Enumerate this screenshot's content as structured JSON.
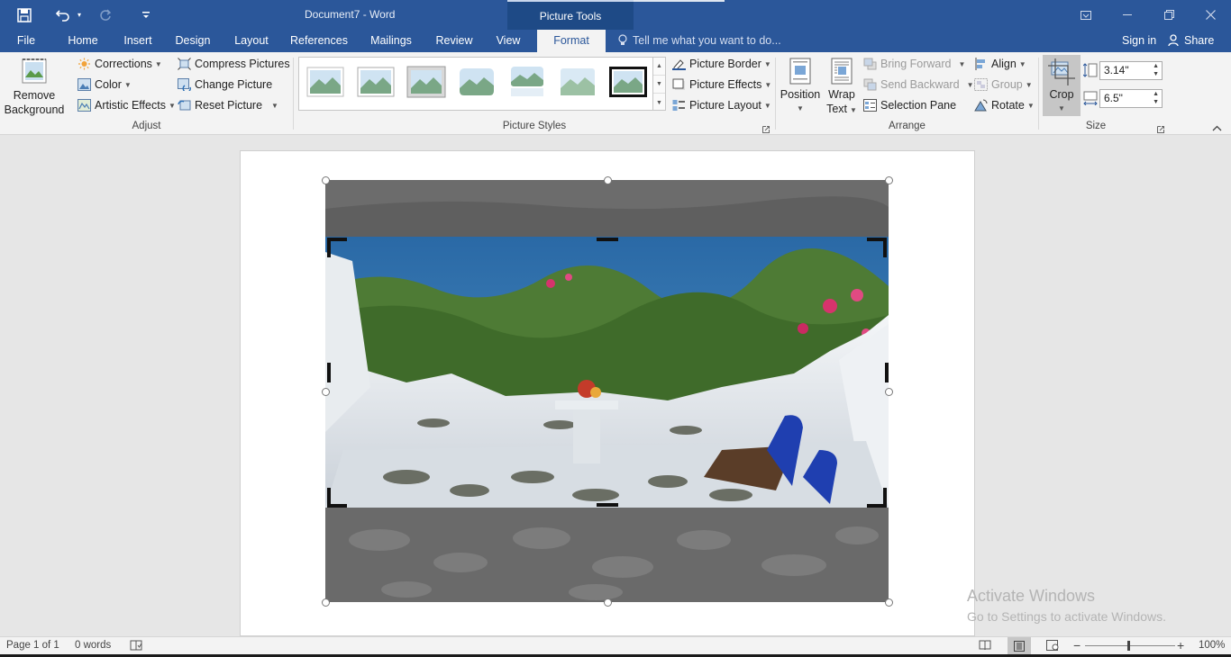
{
  "titlebar": {
    "doc_title": "Document7 - Word",
    "contextual_group": "Picture Tools"
  },
  "tabs": [
    {
      "label": "File"
    },
    {
      "label": "Home"
    },
    {
      "label": "Insert"
    },
    {
      "label": "Design"
    },
    {
      "label": "Layout"
    },
    {
      "label": "References"
    },
    {
      "label": "Mailings"
    },
    {
      "label": "Review"
    },
    {
      "label": "View"
    },
    {
      "label": "Format"
    }
  ],
  "active_tab": "Format",
  "tell_me": "Tell me what you want to do...",
  "sign_in": "Sign in",
  "share": "Share",
  "adjust": {
    "remove_background_1": "Remove",
    "remove_background_2": "Background",
    "corrections": "Corrections",
    "color": "Color",
    "artistic_effects": "Artistic Effects",
    "compress": "Compress Pictures",
    "change": "Change Picture",
    "reset": "Reset Picture",
    "group_label": "Adjust"
  },
  "picture_styles": {
    "group_label": "Picture Styles",
    "border": "Picture Border",
    "effects": "Picture Effects",
    "layout": "Picture Layout"
  },
  "arrange": {
    "position": "Position",
    "wrap_1": "Wrap",
    "wrap_2": "Text",
    "bring_forward": "Bring Forward",
    "send_backward": "Send Backward",
    "selection_pane": "Selection Pane",
    "align": "Align",
    "group": "Group",
    "rotate": "Rotate",
    "group_label": "Arrange"
  },
  "size": {
    "crop": "Crop",
    "height": "3.14\"",
    "width": "6.5\"",
    "group_label": "Size"
  },
  "watermark": {
    "line1": "Activate Windows",
    "line2": "Go to Settings to activate Windows."
  },
  "status": {
    "page": "Page 1 of 1",
    "words": "0 words",
    "zoom": "100%"
  },
  "colors": {
    "brand": "#2b579a",
    "ribbon": "#f3f3f3"
  }
}
